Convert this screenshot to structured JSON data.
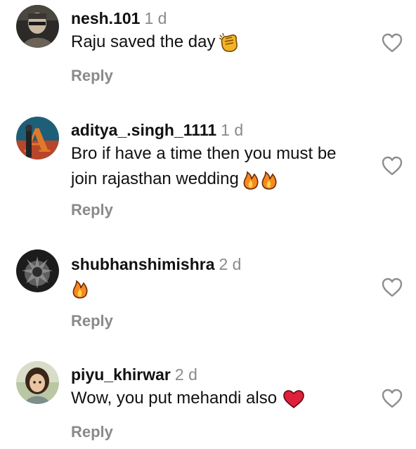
{
  "comments": [
    {
      "username": "nesh.101",
      "time": "1 d",
      "text": "Raju saved the day",
      "emoji": "clapping-hands-icon",
      "reply_label": "Reply"
    },
    {
      "username": "aditya_.singh_1111",
      "time": "1 d",
      "text_line1": "Bro if have a time then you must be",
      "text_line2": "join rajasthan wedding",
      "emoji": "fire-icon",
      "reply_label": "Reply"
    },
    {
      "username": "shubhanshimishra",
      "time": "2 d",
      "text": "",
      "emoji": "fire-icon",
      "reply_label": "Reply"
    },
    {
      "username": "piyu_khirwar",
      "time": "2 d",
      "text": "Wow, you put mehandi also",
      "emoji": "red-heart-icon",
      "reply_label": "Reply"
    }
  ],
  "colors": {
    "text": "#111111",
    "muted": "#8a8a8a",
    "heart_outline": "#8e8e8e",
    "fire": "#f58a1f",
    "clap": "#f2b327",
    "red_heart": "#e0203a"
  }
}
